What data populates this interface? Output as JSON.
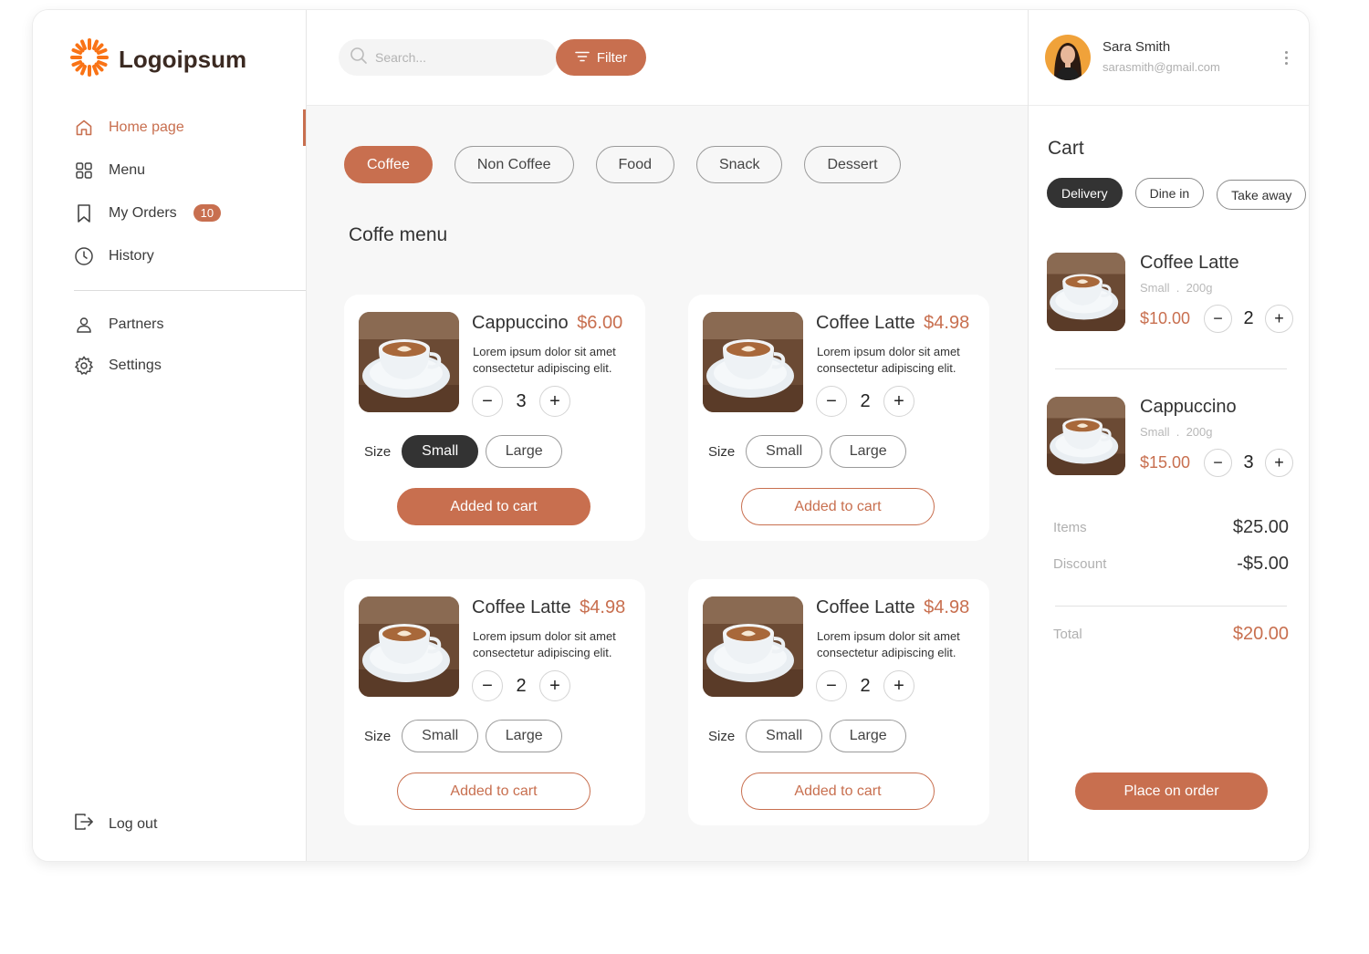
{
  "brand": {
    "name": "Logoipsum",
    "color": "#f97316"
  },
  "colors": {
    "accent": "#c86f4f",
    "dark": "#333333"
  },
  "nav": {
    "items": [
      {
        "label": "Home page",
        "icon": "home-icon",
        "active": true
      },
      {
        "label": "Menu",
        "icon": "grid-icon"
      },
      {
        "label": "My Orders",
        "icon": "bookmark-icon",
        "badge": "10"
      },
      {
        "label": "History",
        "icon": "clock-icon"
      }
    ],
    "secondary": [
      {
        "label": "Partners",
        "icon": "user-icon"
      },
      {
        "label": "Settings",
        "icon": "gear-icon"
      }
    ],
    "logout": "Log out"
  },
  "topbar": {
    "search_placeholder": "Search...",
    "filter_label": "Filter"
  },
  "categories": [
    "Coffee",
    "Non Coffee",
    "Food",
    "Snack",
    "Dessert"
  ],
  "active_category": "Coffee",
  "menu_title": "Coffe menu",
  "products": [
    {
      "name": "Cappuccino",
      "price": "$6.00",
      "desc": "Lorem ipsum dolor sit amet consectetur adipiscing elit.",
      "qty": "3",
      "size_label": "Size",
      "sizes": [
        "Small",
        "Large"
      ],
      "selected_size": "Small",
      "button": "Added to cart",
      "button_filled": true
    },
    {
      "name": "Coffee Latte",
      "price": "$4.98",
      "desc": "Lorem ipsum dolor sit amet consectetur adipiscing elit.",
      "qty": "2",
      "size_label": "Size",
      "sizes": [
        "Small",
        "Large"
      ],
      "selected_size": "",
      "button": "Added to cart",
      "button_filled": false
    },
    {
      "name": "Coffee Latte",
      "price": "$4.98",
      "desc": "Lorem ipsum dolor sit amet consectetur adipiscing elit.",
      "qty": "2",
      "size_label": "Size",
      "sizes": [
        "Small",
        "Large"
      ],
      "selected_size": "",
      "button": "Added to cart",
      "button_filled": false
    },
    {
      "name": "Coffee Latte",
      "price": "$4.98",
      "desc": "Lorem ipsum dolor sit amet consectetur adipiscing elit.",
      "qty": "2",
      "size_label": "Size",
      "sizes": [
        "Small",
        "Large"
      ],
      "selected_size": "",
      "button": "Added to cart",
      "button_filled": false
    }
  ],
  "profile": {
    "name": "Sara Smith",
    "email": "sarasmith@gmail.com"
  },
  "cart": {
    "title": "Cart",
    "order_types": [
      "Delivery",
      "Dine in",
      "Take away"
    ],
    "active_type": "Delivery",
    "items": [
      {
        "name": "Coffee Latte",
        "meta": "Small  .  200g",
        "price": "$10.00",
        "qty": "2"
      },
      {
        "name": "Cappuccino",
        "meta": "Small  .  200g",
        "price": "$15.00",
        "qty": "3"
      }
    ],
    "summary": {
      "items_label": "Items",
      "items_value": "$25.00",
      "discount_label": "Discount",
      "discount_value": "-$5.00",
      "total_label": "Total",
      "total_value": "$20.00"
    },
    "place_order": "Place on order"
  }
}
